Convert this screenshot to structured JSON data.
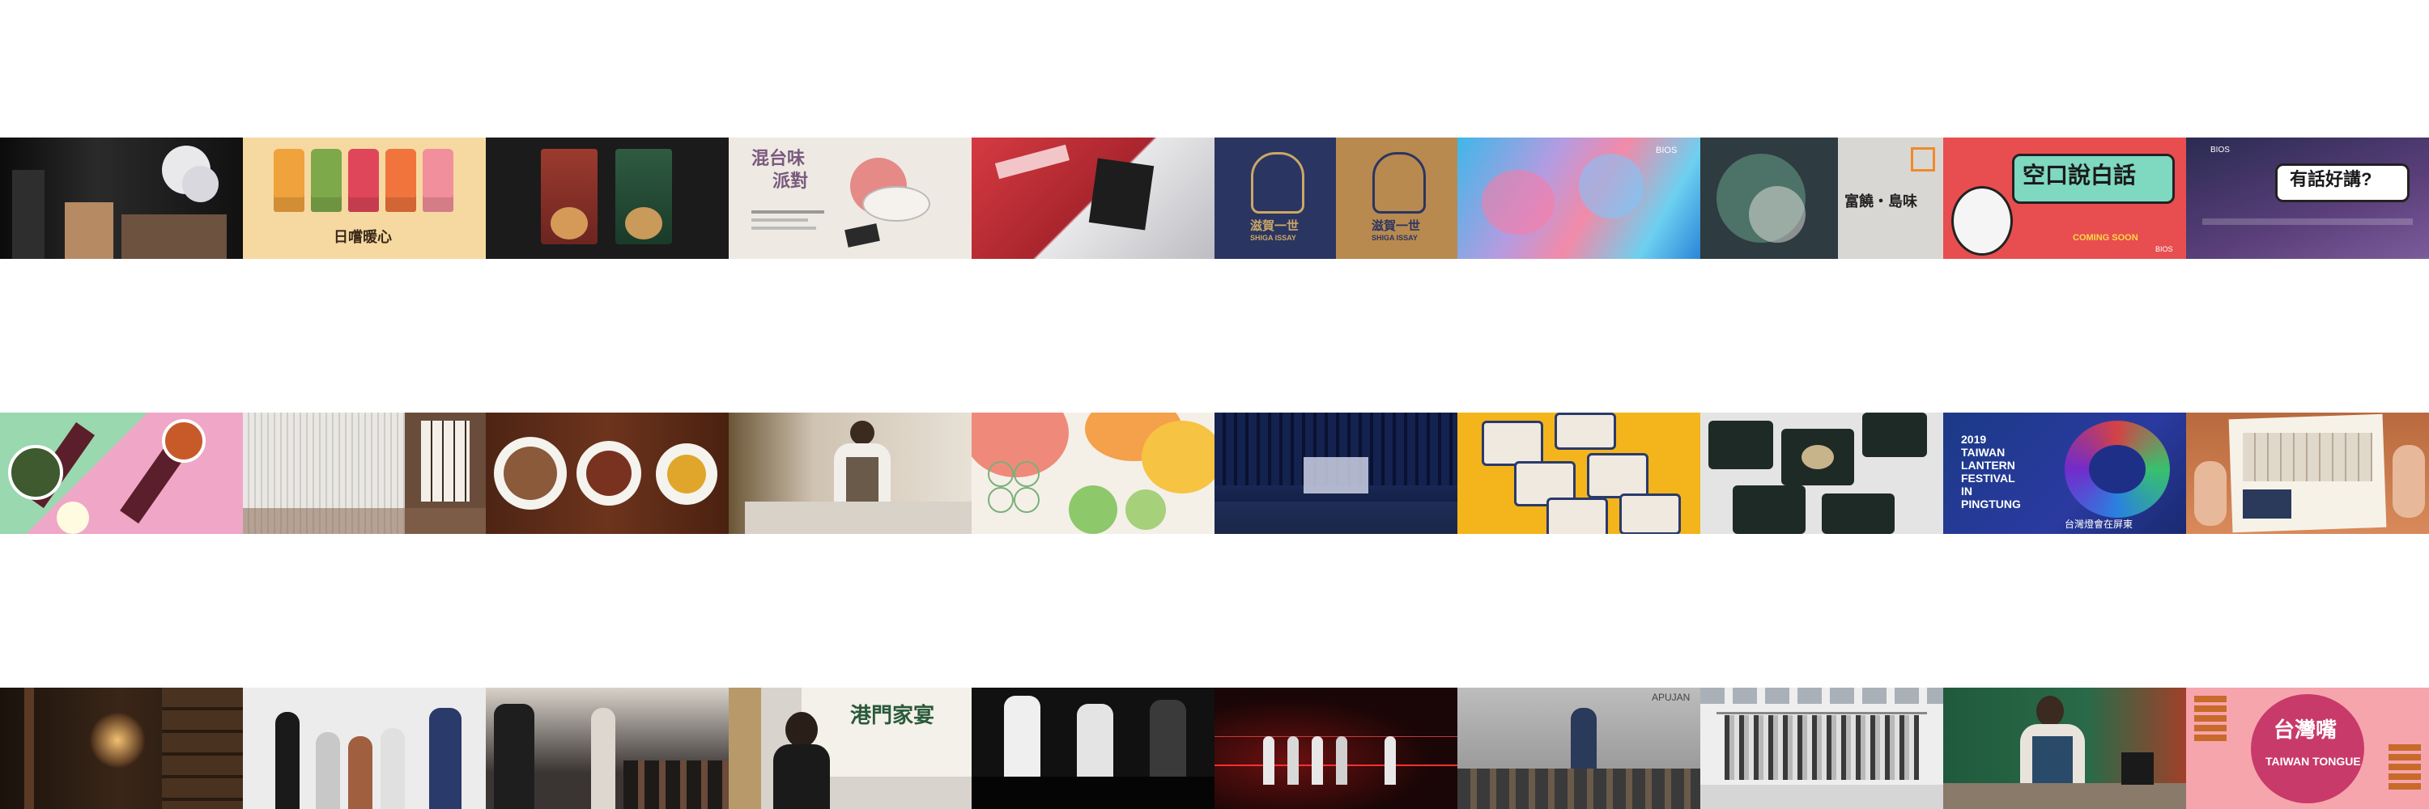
{
  "rows": [
    {
      "tiles": [
        {
          "name": "gallery-tile-exhibition-space",
          "colors": [
            "#121212",
            "#e8e8e8"
          ]
        },
        {
          "name": "gallery-tile-dried-fruit-packs",
          "bg": "#f6d9a1",
          "caption": "日嚐暖心"
        },
        {
          "name": "gallery-tile-coffee-bags",
          "bg": "#1b1b1b"
        },
        {
          "name": "gallery-tile-mixed-taiwan-flavor",
          "bg": "#eeeae3",
          "title_line1": "混台味",
          "title_line2": "派對"
        },
        {
          "name": "gallery-tile-red-packaging",
          "bg": "#c8323a"
        },
        {
          "name": "gallery-tile-shiga-issay",
          "left_bg": "#2b3561",
          "right_bg": "#b88a4f",
          "title": "滋賀一世",
          "subtitle": "SHIGA ISSAY"
        },
        {
          "name": "gallery-tile-bios-gradient",
          "brand": "BIOS"
        },
        {
          "name": "gallery-tile-treasure-island-taste",
          "title": "富饒・島味"
        },
        {
          "name": "gallery-tile-empty-talk",
          "bg": "#e84e4f",
          "title": "空口說白話",
          "tag": "COMING SOON",
          "brand": "BIOS"
        },
        {
          "name": "gallery-tile-something-to-say",
          "bg": "#34355e",
          "title": "有話好講?",
          "brand": "BIOS"
        }
      ]
    },
    {
      "tiles": [
        {
          "name": "gallery-tile-bottles-and-dishes",
          "bg": "#f0a6c6"
        },
        {
          "name": "gallery-tile-white-installation",
          "bg": "#d9d6d2"
        },
        {
          "name": "gallery-tile-food-on-wood",
          "bg": "#5b2c18"
        },
        {
          "name": "gallery-tile-chef-cooking",
          "bg": "#cfc3b2"
        },
        {
          "name": "gallery-tile-colorful-pattern",
          "bg": "#f4f0e8"
        },
        {
          "name": "gallery-tile-dark-hall",
          "bg": "#0e1530"
        },
        {
          "name": "gallery-tile-packaged-meals",
          "bg": "#f3b51b"
        },
        {
          "name": "gallery-tile-dark-meal-boxes",
          "bg": "#e4e4e4"
        },
        {
          "name": "gallery-tile-lantern-festival",
          "bg": "#1b3a86",
          "title_line1": "2019",
          "title_line2": "TAIWAN",
          "title_line3": "LANTERN",
          "title_line4": "FESTIVAL",
          "title_line5": "IN",
          "title_line6": "PINGTUNG",
          "subtitle": "台灣燈會在屏東"
        },
        {
          "name": "gallery-tile-printed-flyer",
          "bg": "#c9794a"
        }
      ]
    },
    {
      "tiles": [
        {
          "name": "gallery-tile-warm-interior",
          "bg": "#2a1c12"
        },
        {
          "name": "gallery-tile-runway-walk",
          "bg": "#e6e6e6"
        },
        {
          "name": "gallery-tile-fashion-audience",
          "bg": "#3a3533"
        },
        {
          "name": "gallery-tile-speaker-banner",
          "bg": "#d8d3cc",
          "title": "港門家宴"
        },
        {
          "name": "gallery-tile-mannequins",
          "bg": "#111111"
        },
        {
          "name": "gallery-tile-red-laser-runway",
          "bg": "#1a0606"
        },
        {
          "name": "gallery-tile-apujan-show",
          "bg": "#a9a9a9",
          "brand": "APUJAN"
        },
        {
          "name": "gallery-tile-clothing-rack",
          "bg": "#eeeeee"
        },
        {
          "name": "gallery-tile-barista",
          "bg": "#1f5a3c"
        },
        {
          "name": "gallery-tile-taiwan-tongue",
          "bg": "#f6a5ad",
          "title": "台灣嘴",
          "subtitle": "TAIWAN TONGUE"
        }
      ]
    }
  ]
}
